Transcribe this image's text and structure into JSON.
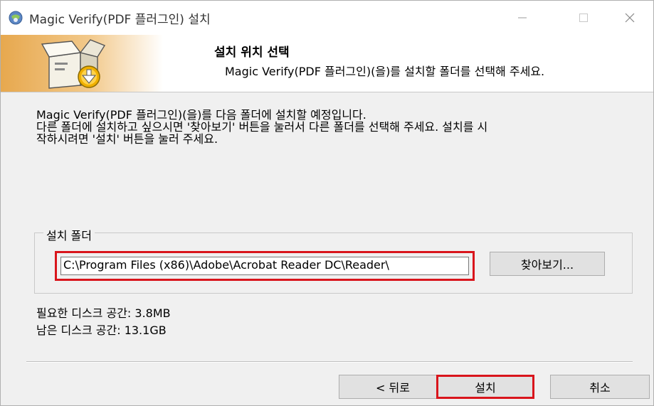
{
  "window": {
    "title": "Magic Verify(PDF 플러그인) 설치",
    "controls": {
      "minimize": "—",
      "maximize": "☐",
      "close": "✕"
    }
  },
  "header": {
    "title": "설치 위치 선택",
    "subtitle": "Magic Verify(PDF 플러그인)(을)를 설치할 폴더를 선택해 주세요.",
    "icon": "installer-box-icon"
  },
  "description": {
    "lines": [
      "Magic Verify(PDF 플러그인)(을)를 다음 폴더에 설치할 예정입니다.",
      "다른 폴더에 설치하고 싶으시면 '찾아보기' 버튼을 눌러서 다른 폴더를 선택해 주세요. 설치를 시",
      "작하시려면 '설치' 버튼을 눌러 주세요."
    ]
  },
  "install_folder": {
    "group_label": "설치 폴더",
    "path": "C:\\Program Files (x86)\\Adobe\\Acrobat Reader DC\\Reader\\",
    "browse_label": "찾아보기..."
  },
  "disk_space": {
    "required": "필요한 디스크 공간: 3.8MB",
    "available": "남은 디스크 공간: 13.1GB"
  },
  "buttons": {
    "back": "< 뒤로",
    "install": "설치",
    "cancel": "취소"
  },
  "colors": {
    "highlight": "#d9151c",
    "banner_accent": "#e7a84e"
  }
}
